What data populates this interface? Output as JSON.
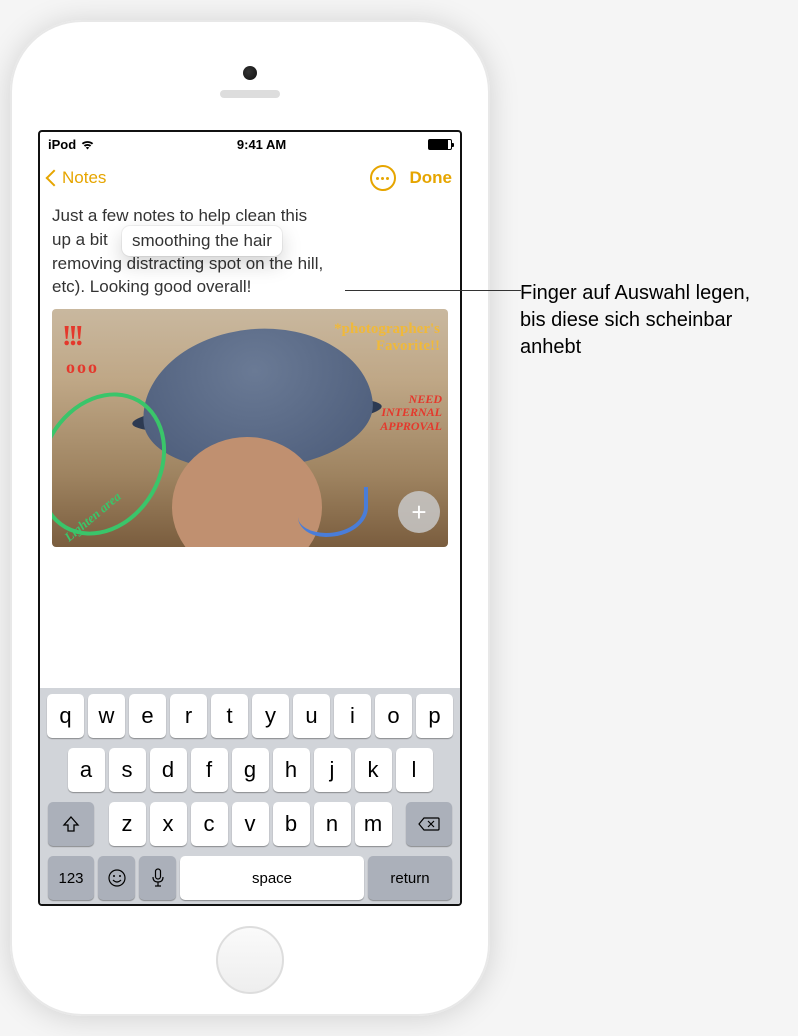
{
  "status": {
    "device": "iPod",
    "time": "9:41 AM"
  },
  "nav": {
    "back_label": "Notes",
    "done_label": "Done"
  },
  "note": {
    "line1": "Just a few notes to help clean this",
    "line2": "up a bit",
    "line3": "removing distracting spot on the hill,",
    "line4": "etc). Looking good overall!"
  },
  "selection": {
    "text": "smoothing the hair"
  },
  "annotations": {
    "yellow": "*photographer's Favorite!!",
    "red_need": "NEED INTERNAL APPROVAL",
    "green": "Lighten area",
    "exclaim": "!!!",
    "circles": "ooo"
  },
  "keyboard": {
    "row1": [
      "q",
      "w",
      "e",
      "r",
      "t",
      "y",
      "u",
      "i",
      "o",
      "p"
    ],
    "row2": [
      "a",
      "s",
      "d",
      "f",
      "g",
      "h",
      "j",
      "k",
      "l"
    ],
    "row3": [
      "z",
      "x",
      "c",
      "v",
      "b",
      "n",
      "m"
    ],
    "space": "space",
    "return": "return",
    "num": "123"
  },
  "callout": {
    "text": "Finger auf Auswahl legen, bis diese sich scheinbar anhebt"
  }
}
